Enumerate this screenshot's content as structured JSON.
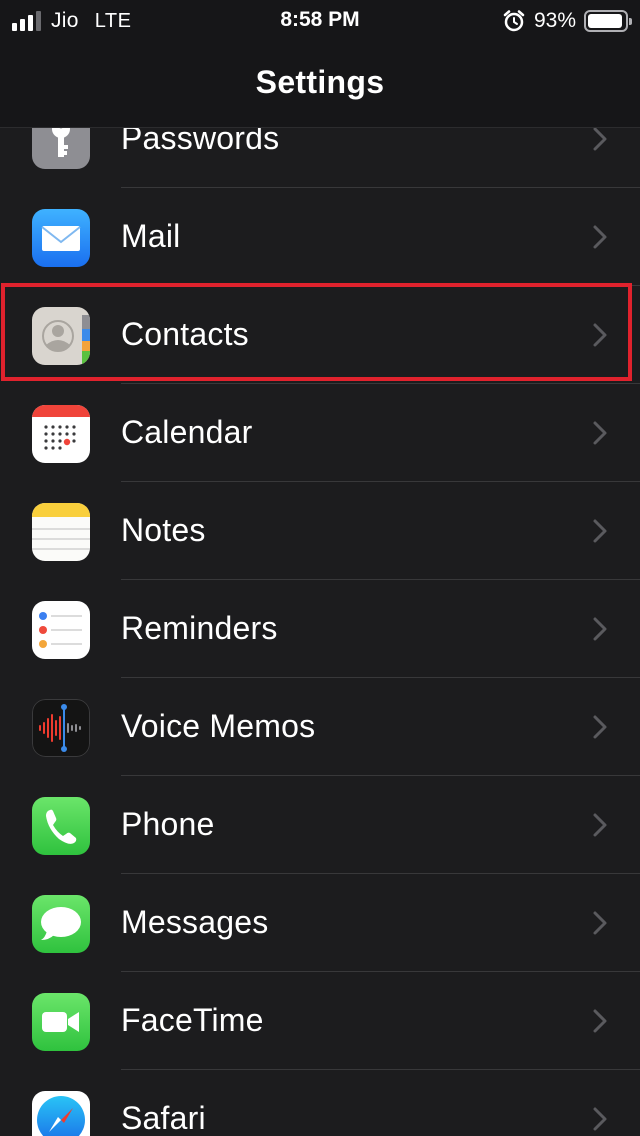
{
  "status_bar": {
    "carrier": "Jio",
    "network": "LTE",
    "time": "8:58 PM",
    "battery_percent": "93%",
    "battery_level": 0.93,
    "icons": [
      "signal-icon",
      "alarm-icon",
      "battery-icon"
    ]
  },
  "nav": {
    "title": "Settings"
  },
  "rows": [
    {
      "label": "Passwords",
      "icon": "passwords-key-icon"
    },
    {
      "label": "Mail",
      "icon": "mail-envelope-icon"
    },
    {
      "label": "Contacts",
      "icon": "contacts-icon"
    },
    {
      "label": "Calendar",
      "icon": "calendar-icon"
    },
    {
      "label": "Notes",
      "icon": "notes-icon"
    },
    {
      "label": "Reminders",
      "icon": "reminders-icon"
    },
    {
      "label": "Voice Memos",
      "icon": "voice-memos-icon"
    },
    {
      "label": "Phone",
      "icon": "phone-icon"
    },
    {
      "label": "Messages",
      "icon": "messages-icon"
    },
    {
      "label": "FaceTime",
      "icon": "facetime-icon"
    },
    {
      "label": "Safari",
      "icon": "safari-icon"
    }
  ],
  "highlighted_row": "Contacts",
  "colors": {
    "background": "#1c1c1e",
    "separator": "#38383a",
    "highlight_border": "#e0222d",
    "chevron": "#5a5a5e"
  }
}
